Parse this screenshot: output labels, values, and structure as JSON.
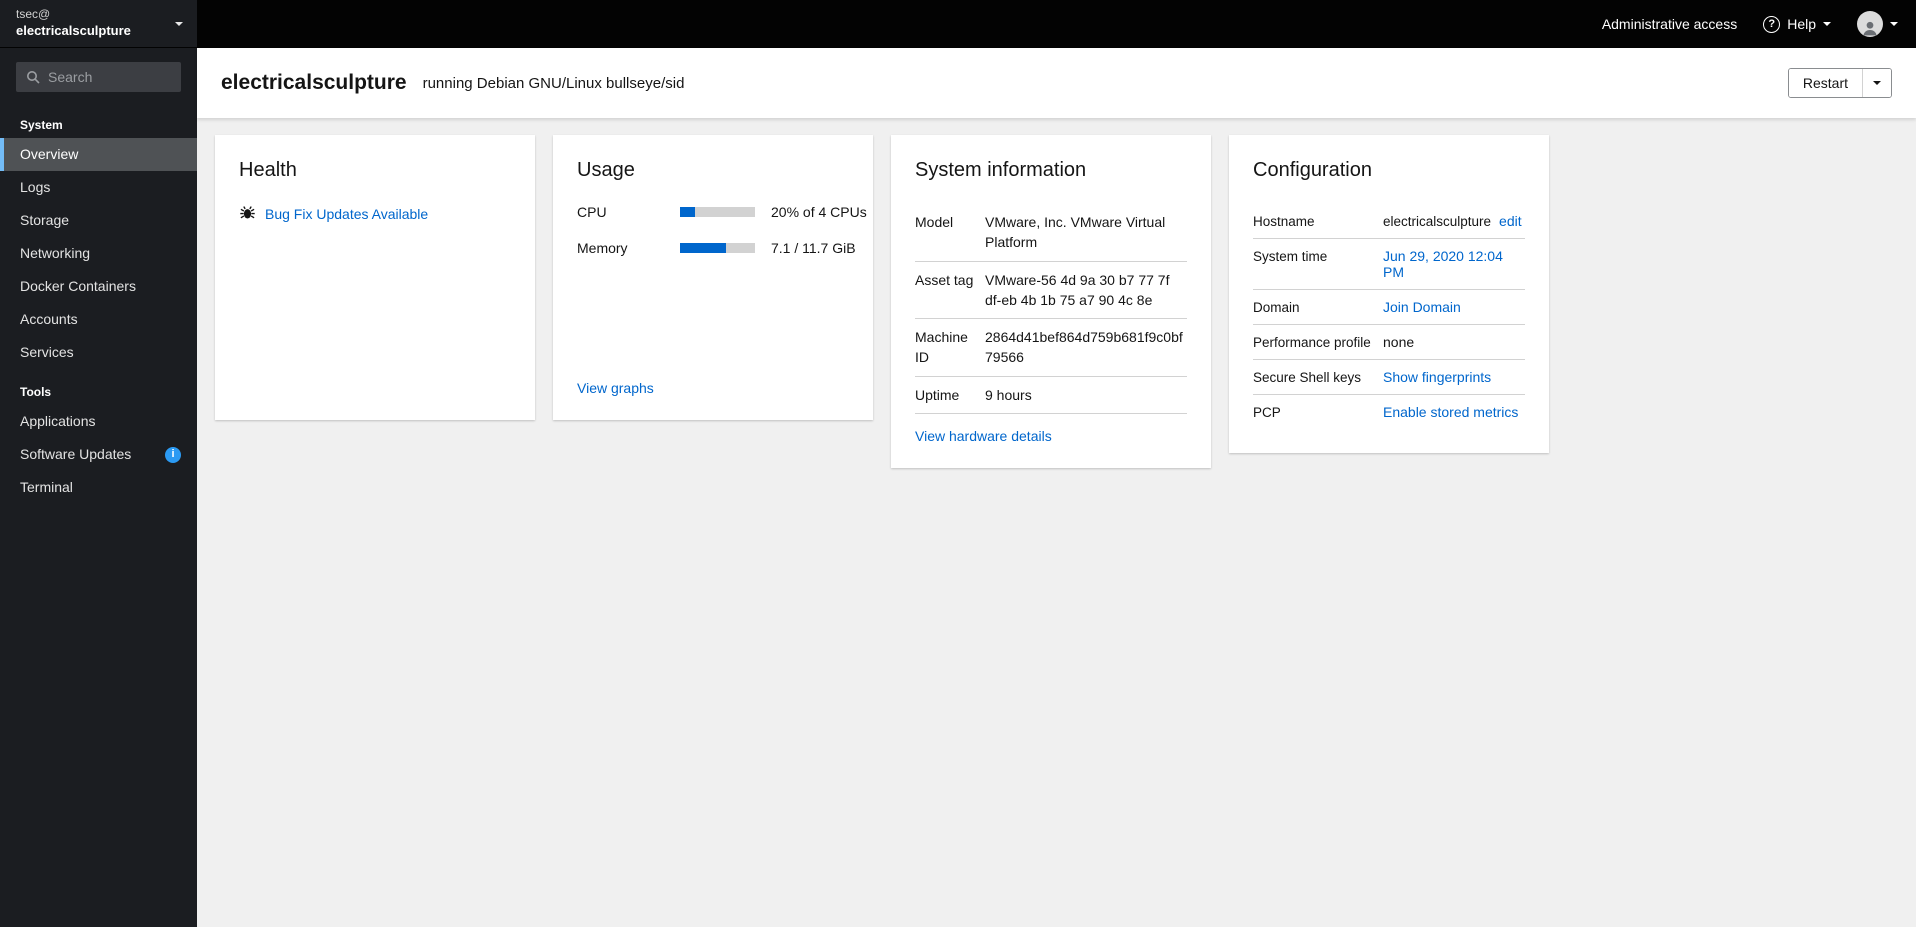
{
  "colors": {
    "link": "#0066cc",
    "progress_fill": "#0066cc",
    "nav_active_indicator": "#73bcf7",
    "info_badge": "#2b9af3"
  },
  "sidebar": {
    "user": "tsec@",
    "host": "electricalsculpture",
    "search_placeholder": "Search",
    "sections": [
      {
        "label": "System",
        "items": [
          {
            "label": "Overview"
          },
          {
            "label": "Logs"
          },
          {
            "label": "Storage"
          },
          {
            "label": "Networking"
          },
          {
            "label": "Docker Containers"
          },
          {
            "label": "Accounts"
          },
          {
            "label": "Services"
          }
        ]
      },
      {
        "label": "Tools",
        "items": [
          {
            "label": "Applications"
          },
          {
            "label": "Software Updates",
            "badge": "i"
          },
          {
            "label": "Terminal"
          }
        ]
      }
    ]
  },
  "masthead": {
    "admin_access": "Administrative access",
    "help": "Help",
    "help_icon": "?"
  },
  "page_header": {
    "hostname": "electricalsculpture",
    "os_text": "running Debian GNU/Linux bullseye/sid",
    "restart_label": "Restart"
  },
  "health": {
    "title": "Health",
    "update_notice": "Bug Fix Updates Available"
  },
  "usage": {
    "title": "Usage",
    "rows": [
      {
        "label": "CPU",
        "value": "20% of 4 CPUs",
        "percent": 20
      },
      {
        "label": "Memory",
        "value": "7.1 / 11.7 GiB",
        "percent": 61
      }
    ],
    "view_graphs": "View graphs"
  },
  "system_information": {
    "title": "System information",
    "rows": [
      {
        "label": "Model",
        "value": "VMware, Inc. VMware Virtual Platform"
      },
      {
        "label": "Asset tag",
        "value": "VMware-56 4d 9a 30 b7 77 7f df-eb 4b 1b 75 a7 90 4c 8e"
      },
      {
        "label": "Machine ID",
        "value": "2864d41bef864d759b681f9c0bf79566"
      },
      {
        "label": "Uptime",
        "value": "9 hours"
      }
    ],
    "view_hardware": "View hardware details"
  },
  "configuration": {
    "title": "Configuration",
    "rows": [
      {
        "label": "Hostname",
        "value": "electricalsculpture",
        "link": "edit"
      },
      {
        "label": "System time",
        "link": "Jun 29, 2020 12:04 PM"
      },
      {
        "label": "Domain",
        "link": "Join Domain"
      },
      {
        "label": "Performance profile",
        "value": "none"
      },
      {
        "label": "Secure Shell keys",
        "link": "Show fingerprints"
      },
      {
        "label": "PCP",
        "link": "Enable stored metrics"
      }
    ]
  }
}
